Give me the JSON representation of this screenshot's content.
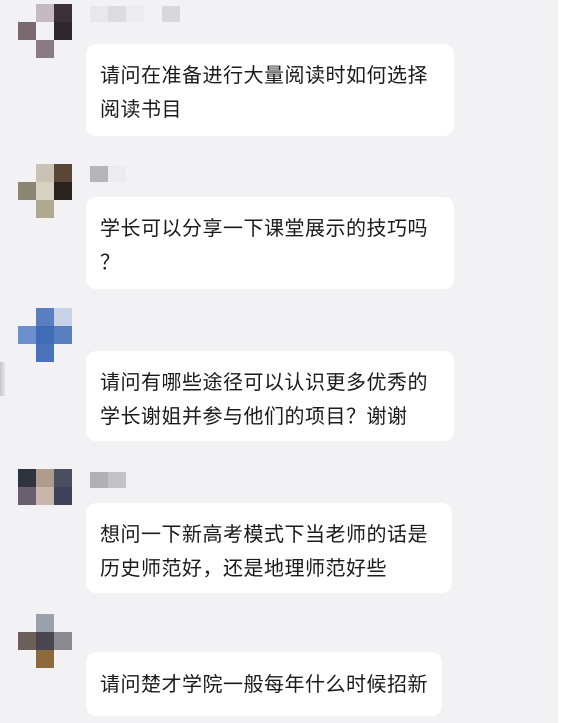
{
  "messages": [
    {
      "id": "m1",
      "lines": [
        "请问在准备进行大量阅读时如何选择",
        "阅读书目"
      ]
    },
    {
      "id": "m2",
      "lines": [
        "学长可以分享一下课堂展示的技巧吗",
        "？"
      ]
    },
    {
      "id": "m3",
      "lines": [
        "请问有哪些途径可以认识更多优秀的",
        "学长谢姐并参与他们的项目？谢谢"
      ]
    },
    {
      "id": "m4",
      "lines": [
        "想问一下新高考模式下当老师的话是",
        "历史师范好，还是地理师范好些"
      ]
    },
    {
      "id": "m5",
      "lines": [
        "请问楚才学院一般每年什么时候招新"
      ]
    }
  ],
  "avatars": {
    "m1": [
      "#f2f2f4",
      "#c7b9c0",
      "#3a3035",
      "#7a6a70",
      "#f2f2f4",
      "#2e282c",
      "#f2f2f4",
      "#8a7a82",
      "#f2f2f4"
    ],
    "m2": [
      "#f2f2f4",
      "#c9c3b5",
      "#5a4636",
      "#8c8670",
      "#d8d2c2",
      "#2a2420",
      "#f2f2f4",
      "#b0a890",
      "#f2f2f4"
    ],
    "m3": [
      "#f2f2f4",
      "#5a7fc0",
      "#c9d3e8",
      "#6d8fd0",
      "#3f6bb8",
      "#5a7fc0",
      "#f2f2f4",
      "#4a72bc",
      "#f2f2f4"
    ],
    "m4": [
      "#2e3340",
      "#b09a8c",
      "#4a4f60",
      "#6a5f70",
      "#c9b5aa",
      "#3c4258",
      "#f2f2f4",
      "#f2f2f4",
      "#f2f2f4"
    ],
    "m5": [
      "#f2f2f4",
      "#9aa0ac",
      "#f2f2f4",
      "#6a6058",
      "#4a4550",
      "#8a8a90",
      "#f2f2f4",
      "#8c6a3e",
      "#f2f2f4"
    ]
  }
}
